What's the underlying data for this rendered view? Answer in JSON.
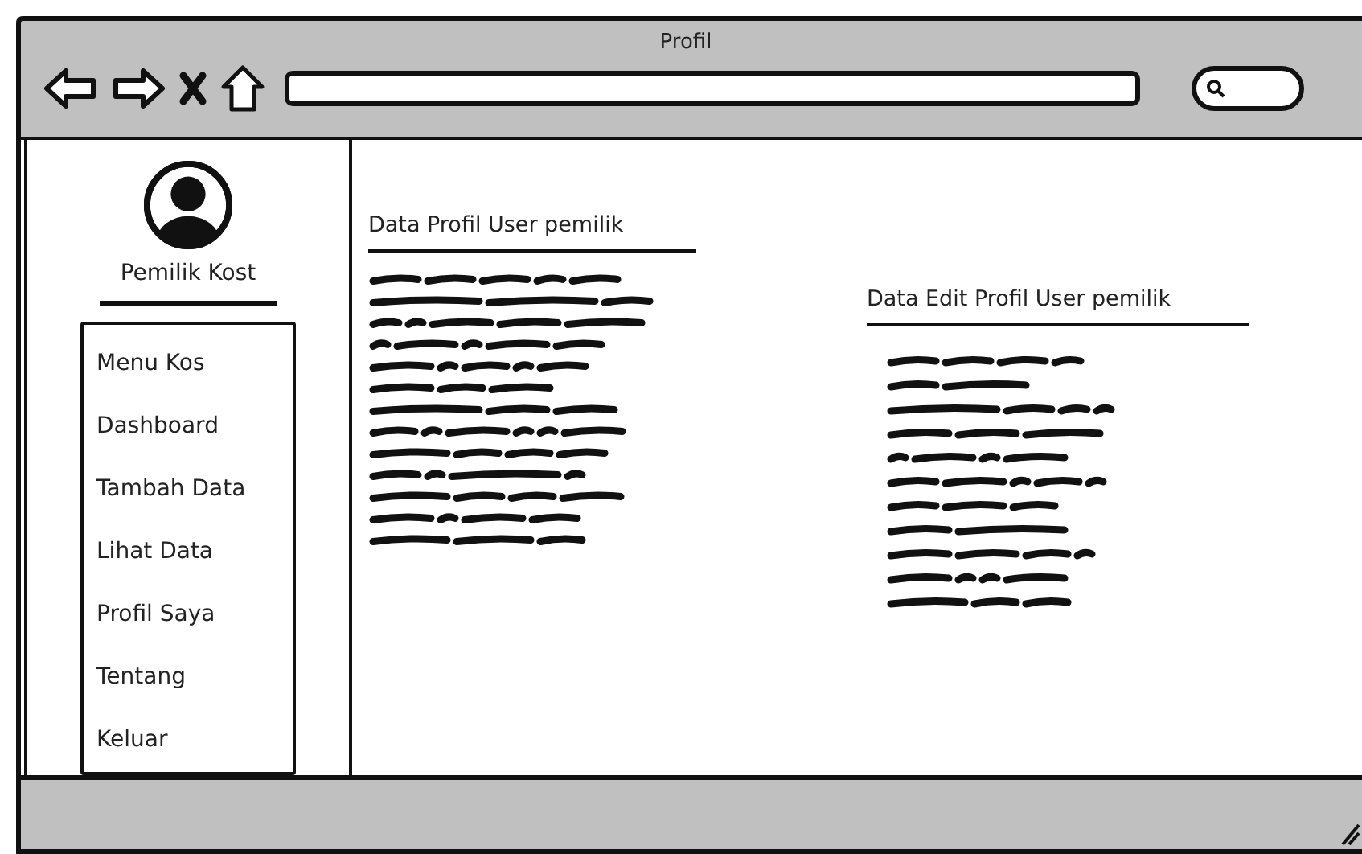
{
  "window": {
    "title": "Profil"
  },
  "sidebar": {
    "user_name": "Pemilik Kost",
    "menu": [
      {
        "label": "Menu Kos"
      },
      {
        "label": "Dashboard"
      },
      {
        "label": "Tambah Data"
      },
      {
        "label": "Lihat Data"
      },
      {
        "label": "Profil Saya"
      },
      {
        "label": "Tentang"
      },
      {
        "label": "Keluar"
      }
    ]
  },
  "sections": [
    {
      "heading": "Data Profil User pemilik"
    },
    {
      "heading": "Data Edit Profil User pemilik"
    }
  ]
}
